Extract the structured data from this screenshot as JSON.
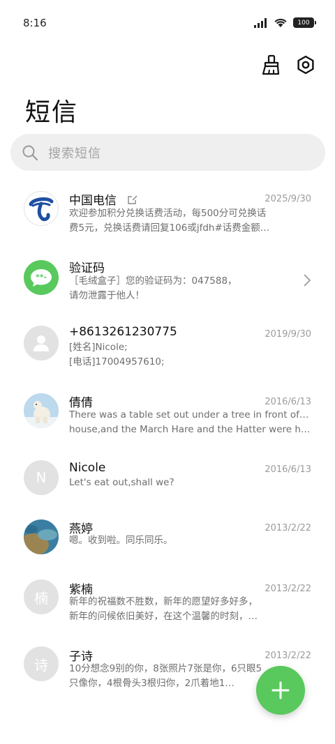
{
  "status": {
    "time": "8:16",
    "battery": "100"
  },
  "title": "短信",
  "search": {
    "placeholder": "搜索短信"
  },
  "colors": {
    "accent": "#59c95d",
    "telecom_blue": "#1e4fa3"
  },
  "conversations": [
    {
      "name": "中国电信",
      "date": "2025/9/30",
      "avatar": "china-telecom-logo",
      "line1": "欢迎参加积分兑换话费活动，每500分可兑换话",
      "line2": "费5元，兑换话费请回复106或jfdh#话费金额…"
    },
    {
      "name": "验证码",
      "date": "",
      "avatar": "verification-code-icon",
      "line1": "［毛绒盒子］您的验证码为：047588，",
      "line2": "请勿泄露于他人！"
    },
    {
      "name": "+8613261230775",
      "date": "2019/9/30",
      "avatar": "person-icon",
      "line1": "[姓名]Nicole;",
      "line2": "[电话]17004957610;"
    },
    {
      "name": "倩倩",
      "date": "2016/6/13",
      "avatar": "polar-bear-photo",
      "line1": "There was a table set out under a tree in front of the",
      "line2": "house,and the March Hare and the Hatter were having t…"
    },
    {
      "name": "Nicole",
      "date": "2016/6/13",
      "avatar_letter": "N",
      "line1": "Let's eat out,shall we?"
    },
    {
      "name": "燕婷",
      "date": "2013/2/22",
      "avatar": "landscape-photo",
      "line1": "嗯。收到啦。同乐同乐。"
    },
    {
      "name": "紫楠",
      "date": "2013/2/22",
      "avatar_letter": "楠",
      "line1": "新年的祝福数不胜数，新年的愿望好多好多，",
      "line2": "新年的问候依旧美好，在这个温馨的时刻，…"
    },
    {
      "name": "子诗",
      "date": "2013/2/22",
      "avatar_letter": "诗",
      "line1": "10分想念9别的你，8张照片7张是你，6只眼5",
      "line2": "只像你，4根骨头3根归你，2爪着地1…"
    }
  ]
}
